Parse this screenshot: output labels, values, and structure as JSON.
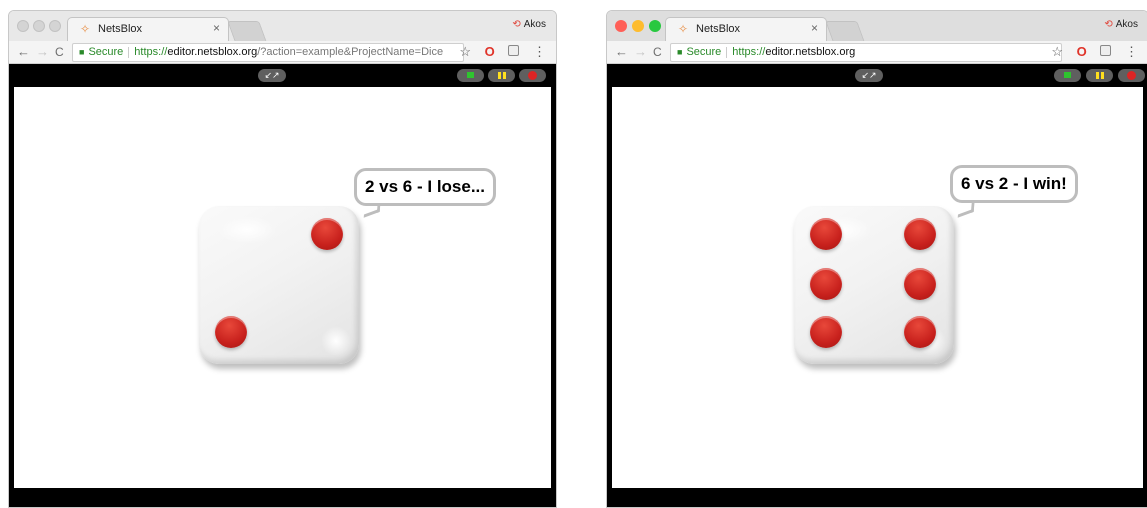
{
  "windows": [
    {
      "tab_title": "NetsBlox",
      "tab_close": "×",
      "user": "Akos",
      "secure_label": "Secure",
      "url_scheme": "https://",
      "url_host": "editor.netsblox.org",
      "url_rest": "/?action=example&ProjectName=Dice",
      "bubble_text": "2 vs 6 - I lose...",
      "die_value": 2
    },
    {
      "tab_title": "NetsBlox",
      "tab_close": "×",
      "user": "Akos",
      "secure_label": "Secure",
      "url_scheme": "https://",
      "url_host": "editor.netsblox.org",
      "url_rest": "",
      "bubble_text": "6 vs 2 - I win!",
      "die_value": 6
    }
  ],
  "icons": {
    "back": "←",
    "forward": "→",
    "reload": "C",
    "lock": "🔒",
    "star": "☆",
    "opera": "O",
    "menu": "⋮",
    "shrink": "↙↗",
    "netsblox_logo": "✧",
    "user_icon": "⟲"
  },
  "colors": {
    "mac_close": "#ff5f57",
    "mac_min": "#febc2e",
    "mac_max": "#28c840",
    "pip_red": "#c8211d",
    "secure_green": "#2a8a2a"
  }
}
